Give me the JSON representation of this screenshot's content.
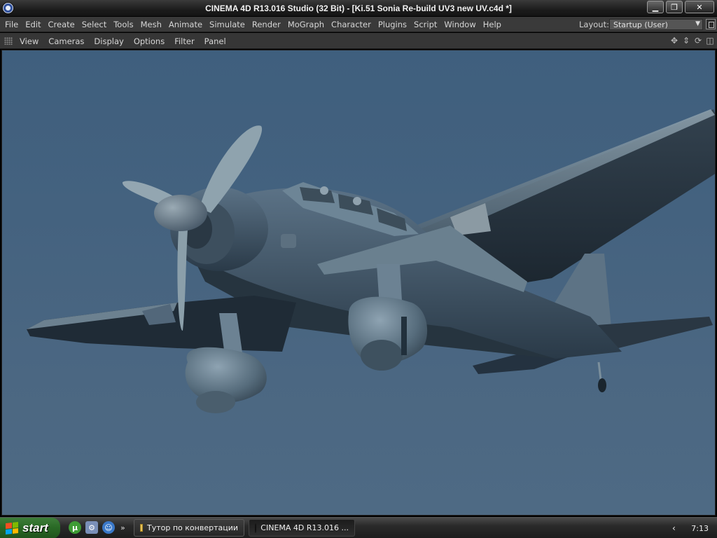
{
  "window": {
    "title": "CINEMA 4D R13.016 Studio (32 Bit) - [Ki.51 Sonia Re-build UV3 new UV.c4d *]",
    "icon": "cinema4d-icon",
    "minimize_label": "▁",
    "maximize_label": "❐",
    "close_label": "✕"
  },
  "menubar": {
    "items": [
      "File",
      "Edit",
      "Create",
      "Select",
      "Tools",
      "Mesh",
      "Animate",
      "Simulate",
      "Render",
      "MoGraph",
      "Character",
      "Plugins",
      "Script",
      "Window",
      "Help"
    ],
    "layout_label": "Layout:",
    "layout_value": "Startup (User)"
  },
  "viewport_toolbar": {
    "items": [
      "View",
      "Cameras",
      "Display",
      "Options",
      "Filter",
      "Panel"
    ],
    "nav_icons": [
      "move-icon",
      "zoom-icon",
      "rotate-icon",
      "toggle-view-icon"
    ]
  },
  "viewport": {
    "sky_color": "#44627f",
    "model_color": "#4a6175"
  },
  "taskbar": {
    "start_label": "start",
    "quick_launch": [
      "utorrent-icon",
      "network-icon",
      "messenger-icon"
    ],
    "tasks": [
      {
        "label": "Тутор по конвертации",
        "icon": "folder-icon",
        "active": false
      },
      {
        "label": "CINEMA 4D R13.016 ...",
        "icon": "cinema4d-icon",
        "active": true
      }
    ],
    "clock": "7:13"
  }
}
